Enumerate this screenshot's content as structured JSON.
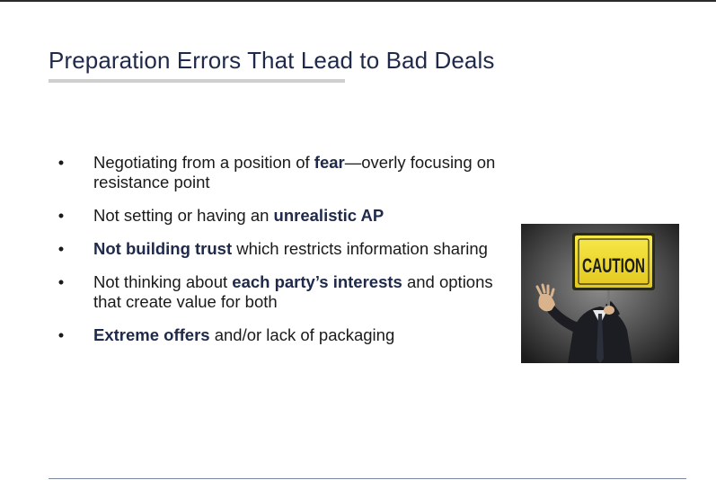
{
  "slide": {
    "title": "Preparation Errors That Lead to Bad Deals",
    "bullet_marker": "•",
    "bullets": [
      {
        "pre": "Negotiating from a position of ",
        "bold": "fear",
        "post": "—overly focusing on resistance point"
      },
      {
        "pre": "Not setting or having an ",
        "bold": "unrealistic AP",
        "post": ""
      },
      {
        "pre": "",
        "bold": "Not building trust",
        "post": " which restricts information sharing"
      },
      {
        "pre": "Not thinking about ",
        "bold": "each party’s interests",
        "post": " and options that create value for both"
      },
      {
        "pre": "",
        "bold": "Extreme offers",
        "post": " and/or lack of packaging"
      }
    ],
    "image": {
      "sign_text": "CAUTION"
    }
  }
}
